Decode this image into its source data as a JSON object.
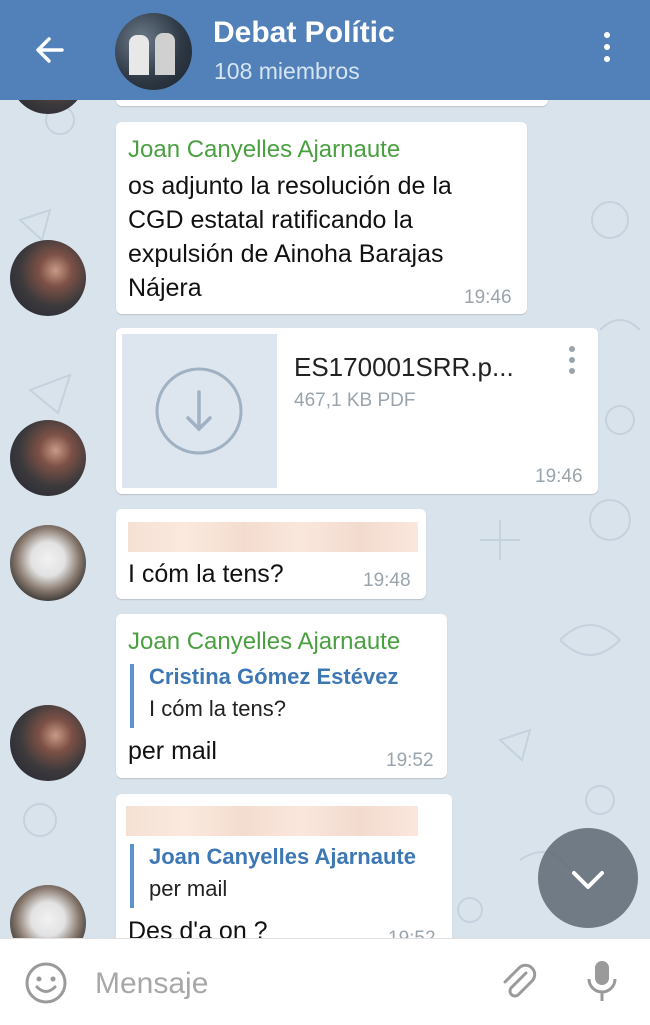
{
  "header": {
    "title": "Debat Polític",
    "subtitle": "108 miembros"
  },
  "messages": [
    {
      "sender": "Joan Canyelles Ajarnaute",
      "lines": [
        "os adjunto la resolución de la",
        "CGD estatal ratificando la",
        "expulsión de Ainoha Barajas",
        "Nájera"
      ],
      "time": "19:46"
    },
    {
      "file_name": "ES170001SRR.p...",
      "file_info": "467,1 KB PDF",
      "time": "19:46"
    },
    {
      "text": "I cóm la tens?",
      "time": "19:48"
    },
    {
      "sender": "Joan Canyelles Ajarnaute",
      "reply_name": "Cristina Gómez Estévez",
      "reply_text": "I cóm la tens?",
      "text": "per mail",
      "time": "19:52"
    },
    {
      "reply_name": "Joan Canyelles Ajarnaute",
      "reply_text": "per mail",
      "text": "Des d'a on ?",
      "time": "19:52"
    }
  ],
  "input": {
    "placeholder": "Mensaje"
  },
  "icons": {
    "back": "arrow-left-icon",
    "menu": "more-vertical-icon",
    "download": "download-icon",
    "scroll_down": "chevron-down-icon",
    "emoji": "emoji-icon",
    "attach": "paperclip-icon",
    "mic": "microphone-icon"
  },
  "colors": {
    "header": "#5181b8",
    "sender": "#4aa041",
    "reply": "#3e78b4"
  }
}
